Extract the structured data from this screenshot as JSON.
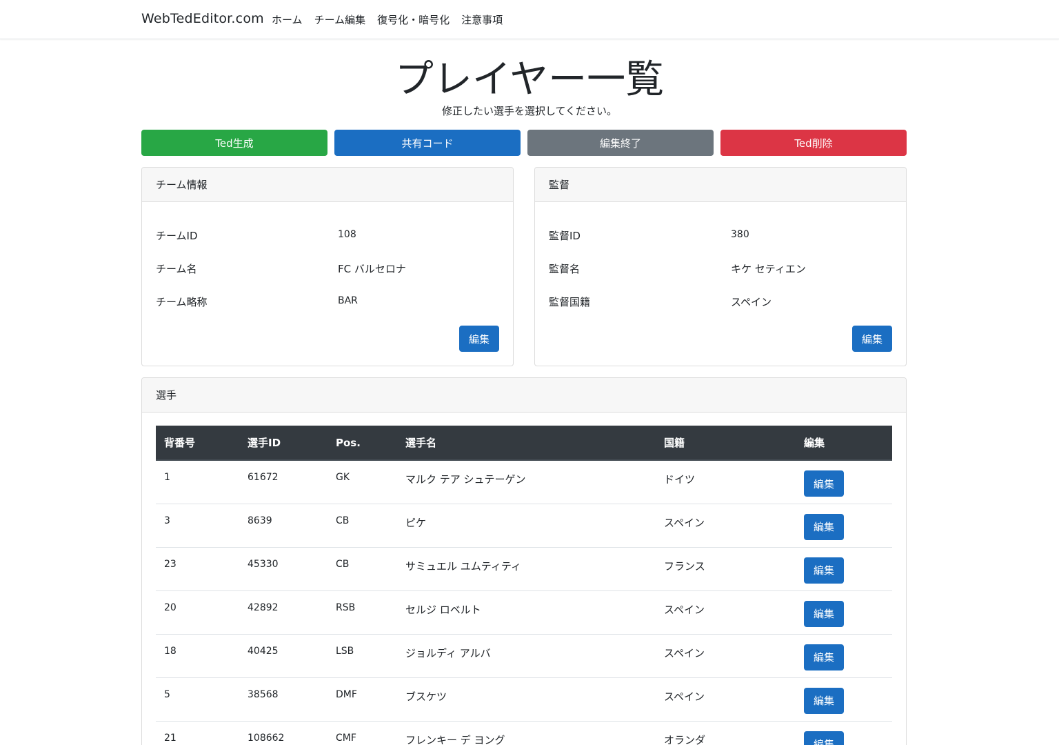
{
  "nav": {
    "brand": "WebTedEditor.com",
    "links": [
      "ホーム",
      "チーム編集",
      "復号化・暗号化",
      "注意事項"
    ]
  },
  "page": {
    "title": "プレイヤー一覧",
    "subtitle": "修正したい選手を選択してください。"
  },
  "actions": {
    "generate": "Ted生成",
    "share": "共有コード",
    "finish": "編集終了",
    "delete": "Ted削除"
  },
  "team_card": {
    "header": "チーム情報",
    "rows": [
      {
        "label": "チームID",
        "value": "108"
      },
      {
        "label": "チーム名",
        "value": "FC バルセロナ"
      },
      {
        "label": "チーム略称",
        "value": "BAR"
      }
    ],
    "edit_label": "編集"
  },
  "manager_card": {
    "header": "監督",
    "rows": [
      {
        "label": "監督ID",
        "value": "380"
      },
      {
        "label": "監督名",
        "value": "キケ セティエン"
      },
      {
        "label": "監督国籍",
        "value": "スペイン"
      }
    ],
    "edit_label": "編集"
  },
  "players_card": {
    "header": "選手",
    "columns": [
      "背番号",
      "選手ID",
      "Pos.",
      "選手名",
      "国籍",
      "編集"
    ],
    "edit_label": "編集",
    "rows": [
      {
        "number": "1",
        "id": "61672",
        "pos": "GK",
        "name": "マルク テア シュテーゲン",
        "nation": "ドイツ"
      },
      {
        "number": "3",
        "id": "8639",
        "pos": "CB",
        "name": "ピケ",
        "nation": "スペイン"
      },
      {
        "number": "23",
        "id": "45330",
        "pos": "CB",
        "name": "サミュエル ユムティティ",
        "nation": "フランス"
      },
      {
        "number": "20",
        "id": "42892",
        "pos": "RSB",
        "name": "セルジ ロベルト",
        "nation": "スペイン"
      },
      {
        "number": "18",
        "id": "40425",
        "pos": "LSB",
        "name": "ジョルディ アルバ",
        "nation": "スペイン"
      },
      {
        "number": "5",
        "id": "38568",
        "pos": "DMF",
        "name": "ブスケツ",
        "nation": "スペイン"
      },
      {
        "number": "21",
        "id": "108662",
        "pos": "CMF",
        "name": "フレンキー デ ヨング",
        "nation": "オランダ"
      }
    ]
  }
}
